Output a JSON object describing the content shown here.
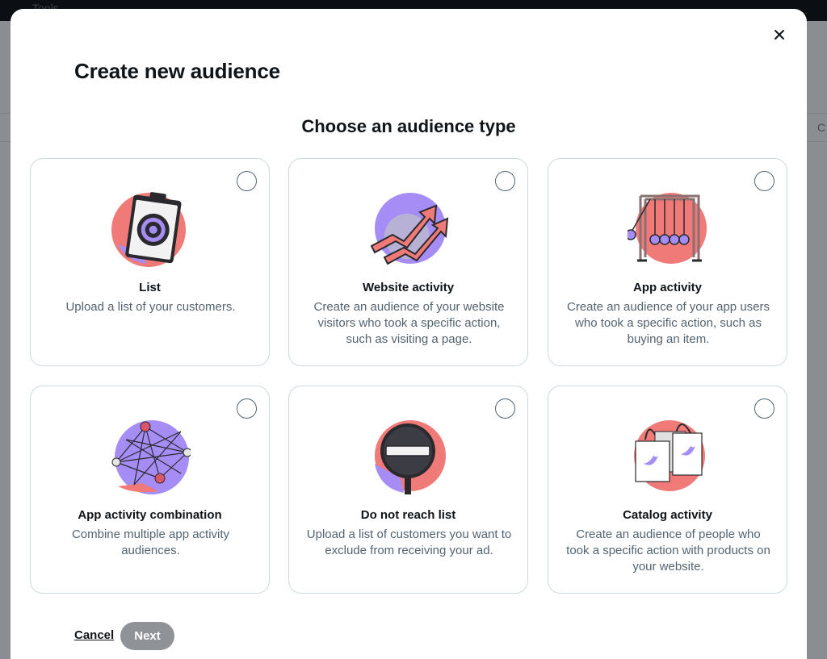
{
  "background": {
    "tools_label": "Tools",
    "right_char": "C"
  },
  "modal": {
    "title": "Create new audience",
    "close_icon": "close-icon",
    "section_title": "Choose an audience type",
    "cards": [
      {
        "title": "List",
        "description": "Upload a list of your customers.",
        "icon": "clipboard-target-icon"
      },
      {
        "title": "Website activity",
        "description": "Create an audience of your website visitors who took a specific action, such as visiting a page.",
        "icon": "website-activity-arrows-icon"
      },
      {
        "title": "App activity",
        "description": "Create an audience of your app users who took a specific action, such as buying an item.",
        "icon": "newtons-cradle-icon"
      },
      {
        "title": "App activity combination",
        "description": "Combine multiple app activity audiences.",
        "icon": "pin-network-icon"
      },
      {
        "title": "Do not reach list",
        "description": "Upload a list of customers you want to exclude from receiving your ad.",
        "icon": "no-entry-sign-icon"
      },
      {
        "title": "Catalog activity",
        "description": "Create an audience of people who took a specific action with products on your website.",
        "icon": "shopping-bags-icon"
      }
    ],
    "cancel_label": "Cancel",
    "next_label": "Next"
  },
  "colors": {
    "coral": "#ef7a78",
    "lavender": "#a68cf5",
    "dark": "#2a2a2e",
    "text_secondary": "#536471",
    "disabled_button": "#8f9296"
  }
}
